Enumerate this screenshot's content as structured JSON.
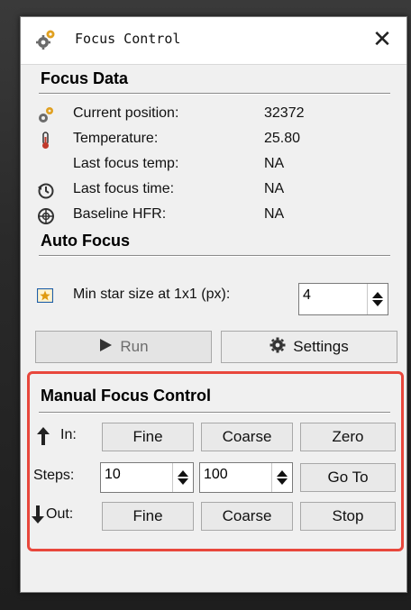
{
  "window": {
    "title": "Focus Control",
    "close_glyph": "✕"
  },
  "focus_data": {
    "section_title": "Focus Data",
    "rows": [
      {
        "icon": "gears-icon",
        "label": "Current position:",
        "value": "32372"
      },
      {
        "icon": "thermometer-icon",
        "label": "Temperature:",
        "value": "25.80"
      },
      {
        "icon": "",
        "label": "Last focus temp:",
        "value": "NA"
      },
      {
        "icon": "history-icon",
        "label": "Last focus time:",
        "value": "NA"
      },
      {
        "icon": "crosshair-icon",
        "label": "Baseline HFR:",
        "value": "NA"
      }
    ]
  },
  "auto_focus": {
    "section_title": "Auto Focus",
    "min_star_label": "Min star size at 1x1 (px):",
    "min_star_value": "4",
    "run_label": "Run",
    "settings_label": "Settings"
  },
  "manual_focus": {
    "section_title": "Manual Focus Control",
    "in_label": "In:",
    "steps_label": "Steps:",
    "out_label": "Out:",
    "in_fine": "Fine",
    "in_coarse": "Coarse",
    "zero": "Zero",
    "fine_steps": "10",
    "coarse_steps": "100",
    "goto": "Go To",
    "out_fine": "Fine",
    "out_coarse": "Coarse",
    "stop": "Stop"
  },
  "colors": {
    "highlight_border": "#e8473c",
    "panel_bg": "#f0f0f0",
    "gear_orange": "#e0a020"
  }
}
